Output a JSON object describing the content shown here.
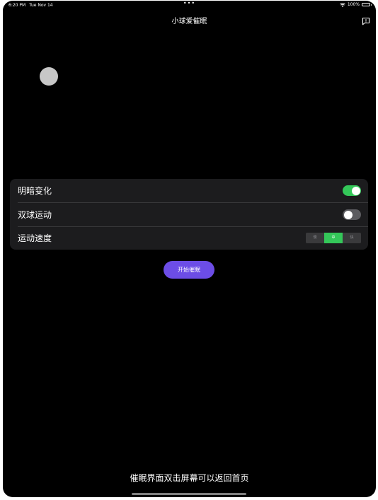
{
  "status_bar": {
    "time": "6:20 PM",
    "date": "Tue Nov 14",
    "center_dots": "•••",
    "battery_text": "100%"
  },
  "nav": {
    "title": "小球爱催眠",
    "right_icon": "feedback-icon"
  },
  "settings": {
    "rows": [
      {
        "label": "明暗变化",
        "control": "toggle",
        "on": true
      },
      {
        "label": "双球运动",
        "control": "toggle",
        "on": false
      },
      {
        "label": "运动速度",
        "control": "segmented",
        "options": [
          "慢",
          "中",
          "快"
        ],
        "selected": "中"
      }
    ]
  },
  "start_button": {
    "label": "开始催眠"
  },
  "footer_hint": "催眠界面双击屏幕可以返回首页",
  "colors": {
    "background": "#000000",
    "card": "#1c1c1e",
    "toggle_on": "#34c759",
    "toggle_off": "#5b5b5f",
    "accent_button": "#6c4de6",
    "ball": "#c7c7c7"
  }
}
